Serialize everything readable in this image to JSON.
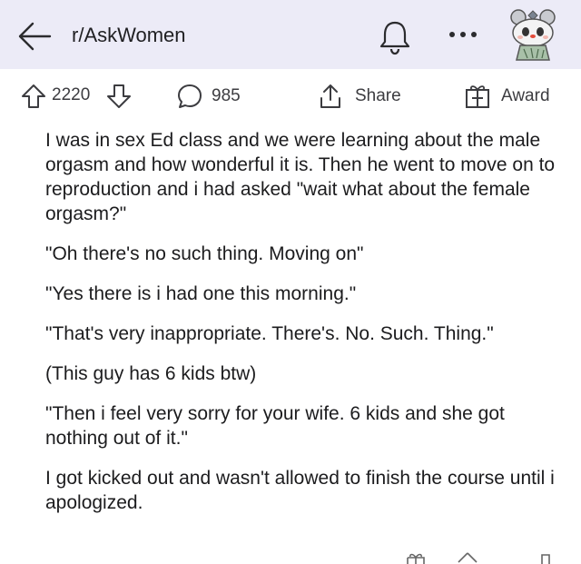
{
  "header": {
    "subreddit": "r/AskWomen"
  },
  "actions": {
    "score": "2220",
    "comments": "985",
    "share": "Share",
    "award": "Award"
  },
  "post": {
    "paragraphs": [
      "I was in sex Ed class and we were learning about the male orgasm and how wonderful it is. Then he went to move on to reproduction and i had asked \"wait what about the female orgasm?\"",
      "\"Oh there's no such thing. Moving on\"",
      "\"Yes there is i had one this morning.\"",
      "\"That's very inappropriate. There's. No. Such. Thing.\"",
      "(This guy has 6 kids btw)",
      "\"Then i feel very sorry for your wife. 6 kids and she got nothing out of it.\"",
      "I got kicked out and wasn't allowed to finish the course until i apologized."
    ]
  },
  "icons": {
    "back": "arrow-left-icon",
    "bell": "bell-icon",
    "more": "more-dots-icon",
    "upvote": "upvote-arrow-icon",
    "downvote": "downvote-arrow-icon",
    "comment": "comment-bubble-icon",
    "share": "share-icon",
    "award": "gift-icon"
  },
  "colors": {
    "header_bg": "#ecebf7",
    "text": "#1c1c1e",
    "icon": "#3c3c40"
  }
}
